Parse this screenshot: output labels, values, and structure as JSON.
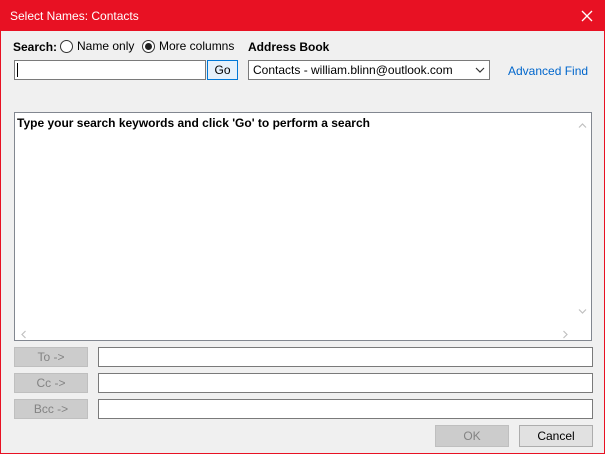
{
  "window": {
    "title": "Select Names: Contacts"
  },
  "search": {
    "label": "Search:",
    "option_name_only": "Name only",
    "option_more_columns": "More columns",
    "selected": "more_columns",
    "value": "",
    "go_label": "Go"
  },
  "address_book": {
    "label": "Address Book",
    "selected": "Contacts - william.blinn@outlook.com",
    "advanced_find": "Advanced Find"
  },
  "results": {
    "hint": "Type your search keywords and click 'Go' to perform a search"
  },
  "recipients": {
    "to_label": "To ->",
    "cc_label": "Cc ->",
    "bcc_label": "Bcc ->",
    "to_value": "",
    "cc_value": "",
    "bcc_value": ""
  },
  "footer": {
    "ok_label": "OK",
    "cancel_label": "Cancel"
  },
  "colors": {
    "titlebar": "#e81123",
    "link": "#0066cc",
    "focus": "#0078d7"
  },
  "icons": {
    "close": "close-icon",
    "dropdown": "chevron-down-icon",
    "scroll_up": "chevron-up-icon",
    "scroll_down": "chevron-down-icon",
    "scroll_left": "chevron-left-icon",
    "scroll_right": "chevron-right-icon"
  }
}
